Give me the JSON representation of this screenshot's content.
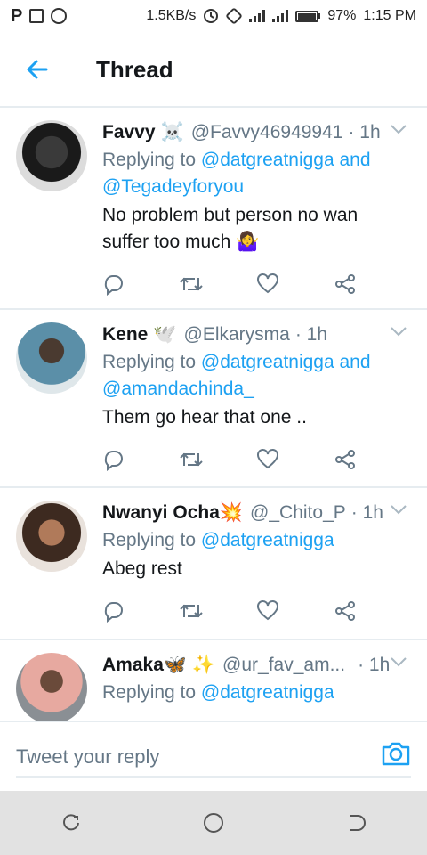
{
  "status_bar": {
    "network_speed": "1.5KB/s",
    "battery_percent": "97%",
    "time": "1:15 PM",
    "left_icons": [
      "pinterest-icon",
      "screenshot-icon",
      "whatsapp-icon"
    ]
  },
  "header": {
    "title": "Thread",
    "accent_color": "#1da1f2"
  },
  "tweets": [
    {
      "name": "Favvy",
      "emoji": "☠️",
      "handle": "@Favvy46949941",
      "time": "· 1h",
      "reply_prefix": "Replying to ",
      "mentions_line1": "@datgreatnigga and",
      "mentions_line2": "@Tegadeyforyou",
      "text_line1": "No problem but person no wan",
      "text_line2": "suffer too much 🤷‍♀️"
    },
    {
      "name": "Kene",
      "emoji": "🕊️",
      "handle": "@Elkarysma",
      "time": "· 1h",
      "reply_prefix": "Replying to ",
      "mentions_line1": "@datgreatnigga and",
      "mentions_line2": "@amandachinda_",
      "text_line1": "Them go hear that one .."
    },
    {
      "name": "Nwanyi Ocha",
      "emoji": "💥",
      "handle": "@_Chito_P",
      "time": "· 1h",
      "reply_prefix": "Replying to ",
      "mentions_line1": "@datgreatnigga",
      "text_line1": "Abeg rest"
    },
    {
      "name": "Amaka",
      "emoji": "🦋 ✨",
      "handle": "@ur_fav_am...",
      "time": "· 1h",
      "reply_prefix": "Replying to ",
      "mentions_line1": "@datgreatnigga"
    }
  ],
  "reply_bar": {
    "placeholder": "Tweet your reply"
  }
}
